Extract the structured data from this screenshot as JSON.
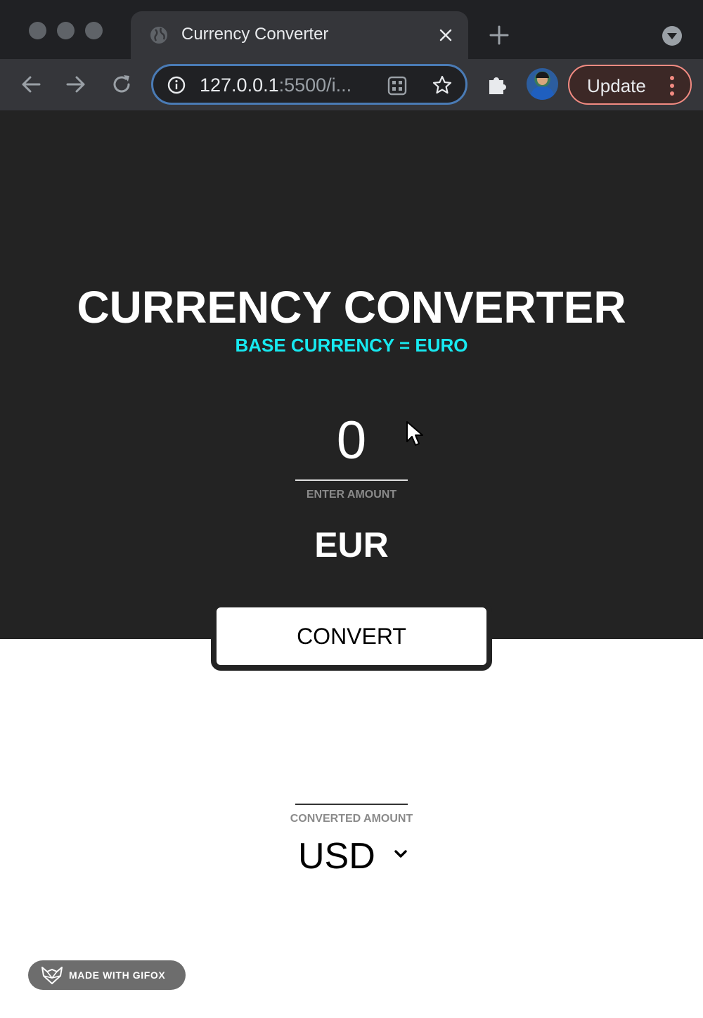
{
  "browser": {
    "tab_title": "Currency Converter",
    "url_host": "127.0.0.1",
    "url_rest": ":5500/i...",
    "update_label": "Update"
  },
  "app": {
    "title": "CURRENCY CONVERTER",
    "subtitle": "BASE CURRENCY = EURO",
    "amount_value": "0",
    "amount_label": "ENTER AMOUNT",
    "base_currency": "EUR",
    "convert_label": "CONVERT",
    "converted_label": "CONVERTED AMOUNT",
    "target_currency": "USD"
  },
  "watermark": {
    "label": "MADE WITH GIFOX"
  },
  "colors": {
    "page_dark": "#232323",
    "accent_cyan": "#17e9f0",
    "update_border": "#f28b82",
    "omnibox_focus": "#4a7bb5"
  }
}
